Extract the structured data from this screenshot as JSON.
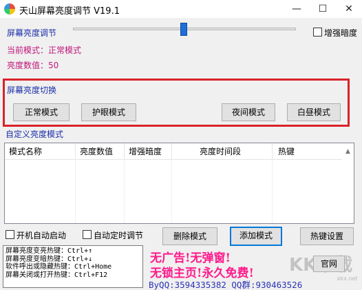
{
  "window": {
    "title": "天山屏幕亮度调节 V19.1",
    "icon": "app-logo-icon",
    "minimize": "—",
    "maximize": "☐",
    "close": "✕"
  },
  "brightness": {
    "slider_label": "屏幕亮度调节",
    "slider_value_percent": 50,
    "enhance_label": "增强暗度",
    "enhance_checked": false,
    "current_mode_label": "当前模式：正常模式",
    "value_label": "亮度数值：50"
  },
  "mode_switch": {
    "title": "屏幕亮度切换",
    "buttons": [
      "正常模式",
      "护眼模式",
      "夜间模式",
      "白昼模式"
    ]
  },
  "custom": {
    "title": "自定义亮度模式",
    "columns": [
      "模式名称",
      "亮度数值",
      "增强暗度",
      "亮度时间段",
      "热键"
    ],
    "rows": []
  },
  "options": {
    "autostart_label": "开机自动启动",
    "auto_timer_label": "自动定时调节",
    "delete_button": "删除模式",
    "add_button": "添加模式",
    "hotkey_button": "热键设置",
    "official_button": "官网"
  },
  "hotkeys": [
    "屏幕亮度变亮热键：Ctrl+↑",
    "屏幕亮度变暗热键：Ctrl+↓",
    "软件呼出或隐藏热键：Ctrl+Home",
    "屏幕关闭或打开热键：Ctrl+F12"
  ],
  "promo": {
    "line1": "无广告!无弹窗!",
    "line2": "无锁主页!永久免费!",
    "contact": "ByQQ:3594335382 QQ群:930463526"
  },
  "watermark": {
    "text": "KK下载",
    "sub": "kkx.net"
  },
  "colors": {
    "accent_blue": "#1c2fa8",
    "highlight_magenta": "#c0177a",
    "promo_pink": "#ff1a8c",
    "frame_red": "#d9222a",
    "slider_blue": "#1e6fd9"
  }
}
